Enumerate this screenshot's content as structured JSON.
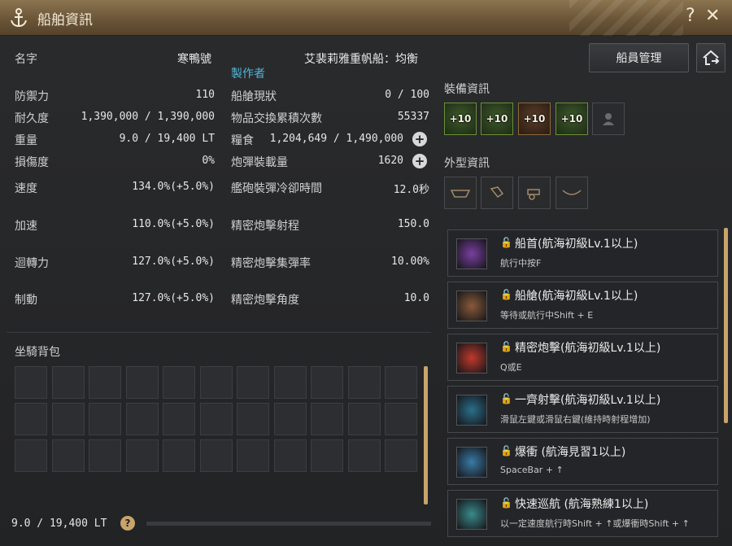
{
  "window": {
    "title": "船舶資訊"
  },
  "ship": {
    "name_label": "名字",
    "name_value": "寒鴨號",
    "type": "艾裴莉雅重帆船：均衡",
    "maker_label": "製作者"
  },
  "stats_left": [
    {
      "label": "防禦力",
      "value": "110"
    },
    {
      "label": "耐久度",
      "value": "1,390,000 / 1,390,000"
    },
    {
      "label": "重量",
      "value": "9.0 / 19,400 LT"
    },
    {
      "label": "損傷度",
      "value": "0%"
    },
    {
      "label": "速度",
      "value": "134.0%(+5.0%)"
    },
    {
      "label": "加速",
      "value": "110.0%(+5.0%)"
    },
    {
      "label": "迴轉力",
      "value": "127.0%(+5.0%)"
    },
    {
      "label": "制動",
      "value": "127.0%(+5.0%)"
    }
  ],
  "stats_mid": [
    {
      "label": "船艙現狀",
      "value": "0 / 100"
    },
    {
      "label": "物品交換累積次數",
      "value": "55337"
    },
    {
      "label": "糧食",
      "value": "1,204,649 / 1,490,000"
    },
    {
      "label": "炮彈裝載量",
      "value": "1620"
    },
    {
      "label": "艦砲裝彈冷卻時間",
      "value": "12.0秒"
    },
    {
      "label": "精密炮擊射程",
      "value": "150.0"
    },
    {
      "label": "精密炮擊集彈率",
      "value": "10.00%"
    },
    {
      "label": "精密炮擊角度",
      "value": "10.0"
    }
  ],
  "buttons": {
    "crew_manage": "船員管理"
  },
  "equipment": {
    "title": "裝備資訊",
    "slots": [
      "+10",
      "+10",
      "+10",
      "+10"
    ]
  },
  "appearance": {
    "title": "外型資訊"
  },
  "backpack": {
    "title": "坐騎背包",
    "weight": "9.0 / 19,400 LT"
  },
  "skills": [
    {
      "name": "船首(航海初級Lv.1以上)",
      "key": "航行中按F",
      "color": "#7a3fa0"
    },
    {
      "name": "船艙(航海初級Lv.1以上)",
      "key": "等待或航行中Shift + E",
      "color": "#8a5a3a"
    },
    {
      "name": "精密炮擊(航海初級Lv.1以上)",
      "key": "Q或E",
      "color": "#c0392b"
    },
    {
      "name": "一齊射擊(航海初級Lv.1以上)",
      "key": "滑鼠左鍵或滑鼠右鍵(維持時射程增加)",
      "color": "#2a6f8a"
    },
    {
      "name": "爆衝 (航海見習1以上)",
      "key": "SpaceBar + ↑",
      "color": "#3a7aa5"
    },
    {
      "name": "快速巡航 (航海熟練1以上)",
      "key": "以一定速度航行時Shift + ↑或爆衝時Shift + ↑",
      "color": "#3a8a8a"
    }
  ],
  "icons": {
    "anchor": "anchor-icon",
    "help": "help-icon",
    "close": "close-icon",
    "lock": "lock-icon"
  }
}
